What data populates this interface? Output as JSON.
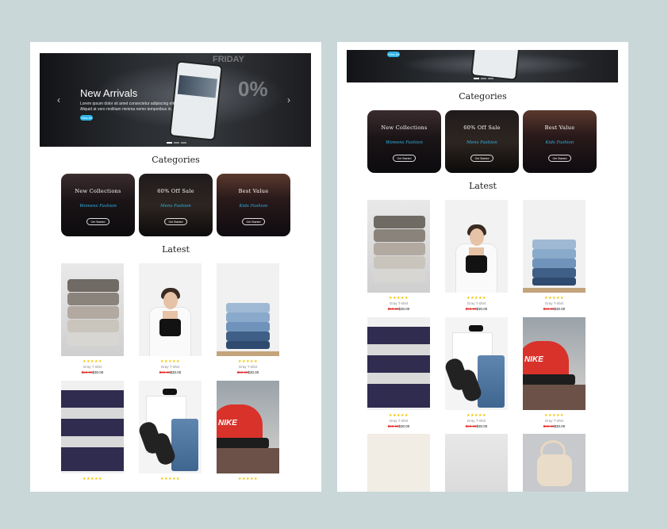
{
  "hero": {
    "title": "New Arrivals",
    "subtitle": "Lorem ipsum dolor sit amet consectetur adipiscing elit. Aliquid at vero molitiam minima nemo temporibus in.",
    "button_label": "View All",
    "sign_text_1": "FRIDAY",
    "sign_text_2": "0%"
  },
  "categories": {
    "heading": "Categories",
    "items": [
      {
        "title": "New  Collections",
        "script": "Womens Fashion",
        "button": "Get Started"
      },
      {
        "title": "60%  Off  Sale",
        "script": "Mens Fashion",
        "button": "Get Started"
      },
      {
        "title": "Best  Value",
        "script": "Kids Fashion",
        "button": "Get Started"
      }
    ]
  },
  "latest": {
    "heading": "Latest",
    "products": [
      {
        "name": "Gray T-shirt",
        "old_price": "$50.00",
        "price": "$30.00",
        "stars": "★★★★★"
      },
      {
        "name": "Gray T-shirt",
        "old_price": "$50.00",
        "price": "$30.00",
        "stars": "★★★★★"
      },
      {
        "name": "Gray T-shirt",
        "old_price": "$50.00",
        "price": "$30.00",
        "stars": "★★★★★"
      },
      {
        "name": "Gray T-shirt",
        "old_price": "$50.00",
        "price": "$30.00",
        "stars": "★★★★★"
      },
      {
        "name": "Gray T-shirt",
        "old_price": "$50.00",
        "price": "$30.00",
        "stars": "★★★★★"
      },
      {
        "name": "Gray T-shirt",
        "old_price": "$50.00",
        "price": "$30.00",
        "stars": "★★★★★"
      }
    ]
  },
  "icons": {
    "prev": "chevron-left-icon",
    "next": "chevron-right-icon",
    "star": "star-icon"
  },
  "colors": {
    "background": "#c9d7d9",
    "accent": "#2cb4e6",
    "star": "#f3c300",
    "sale_price": "#e02424"
  }
}
